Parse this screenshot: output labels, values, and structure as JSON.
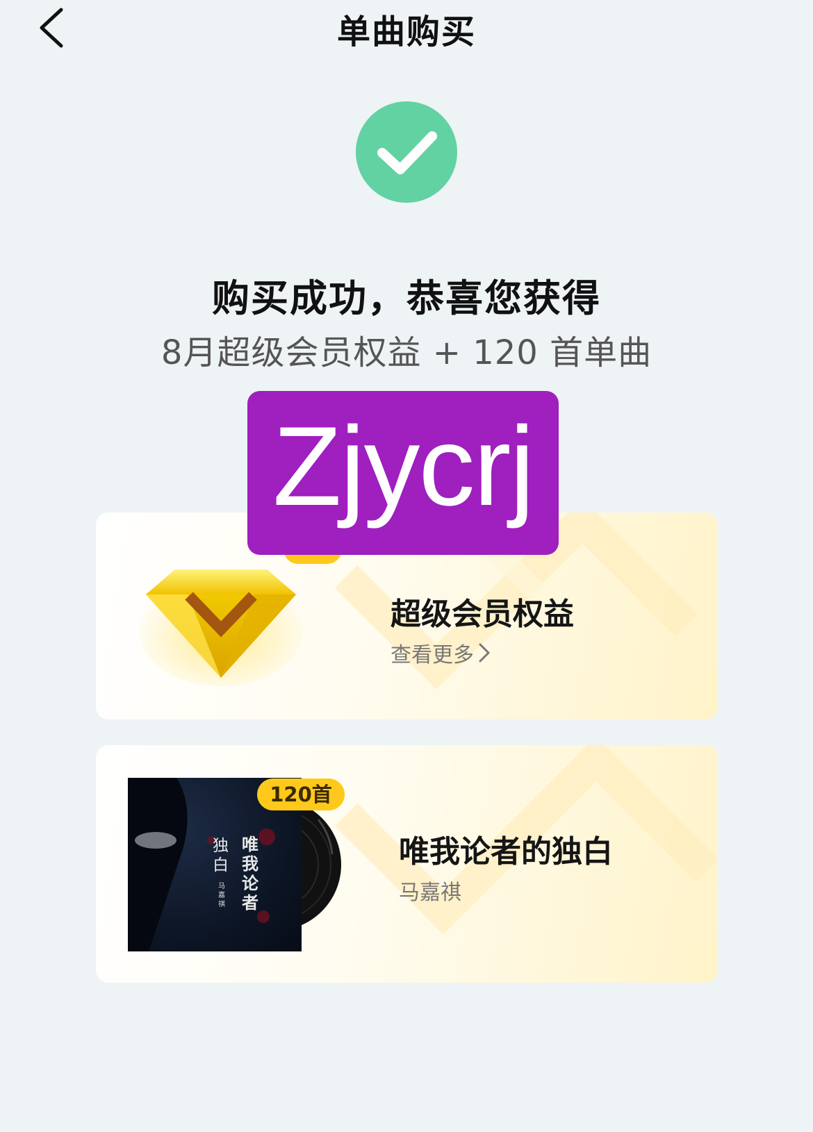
{
  "header": {
    "title": "单曲购买"
  },
  "result": {
    "headline": "购买成功，恭喜您获得",
    "subline": "8月超级会员权益 + 120 首单曲"
  },
  "watermark": {
    "text": "Zjycrj"
  },
  "vip_card": {
    "title": "超级会员权益",
    "more_label": "查看更多"
  },
  "album_card": {
    "count_badge": "120首",
    "title": "唯我论者的独白",
    "artist": "马嘉祺",
    "cover_title_right": "唯我论者",
    "cover_title_left": "独白",
    "cover_artist": "马嘉祺"
  },
  "colors": {
    "success_green": "#62d2a2",
    "badge_yellow": "#ffc91c",
    "watermark_purple": "#9f1fbf",
    "page_bg": "#eef3f6"
  }
}
